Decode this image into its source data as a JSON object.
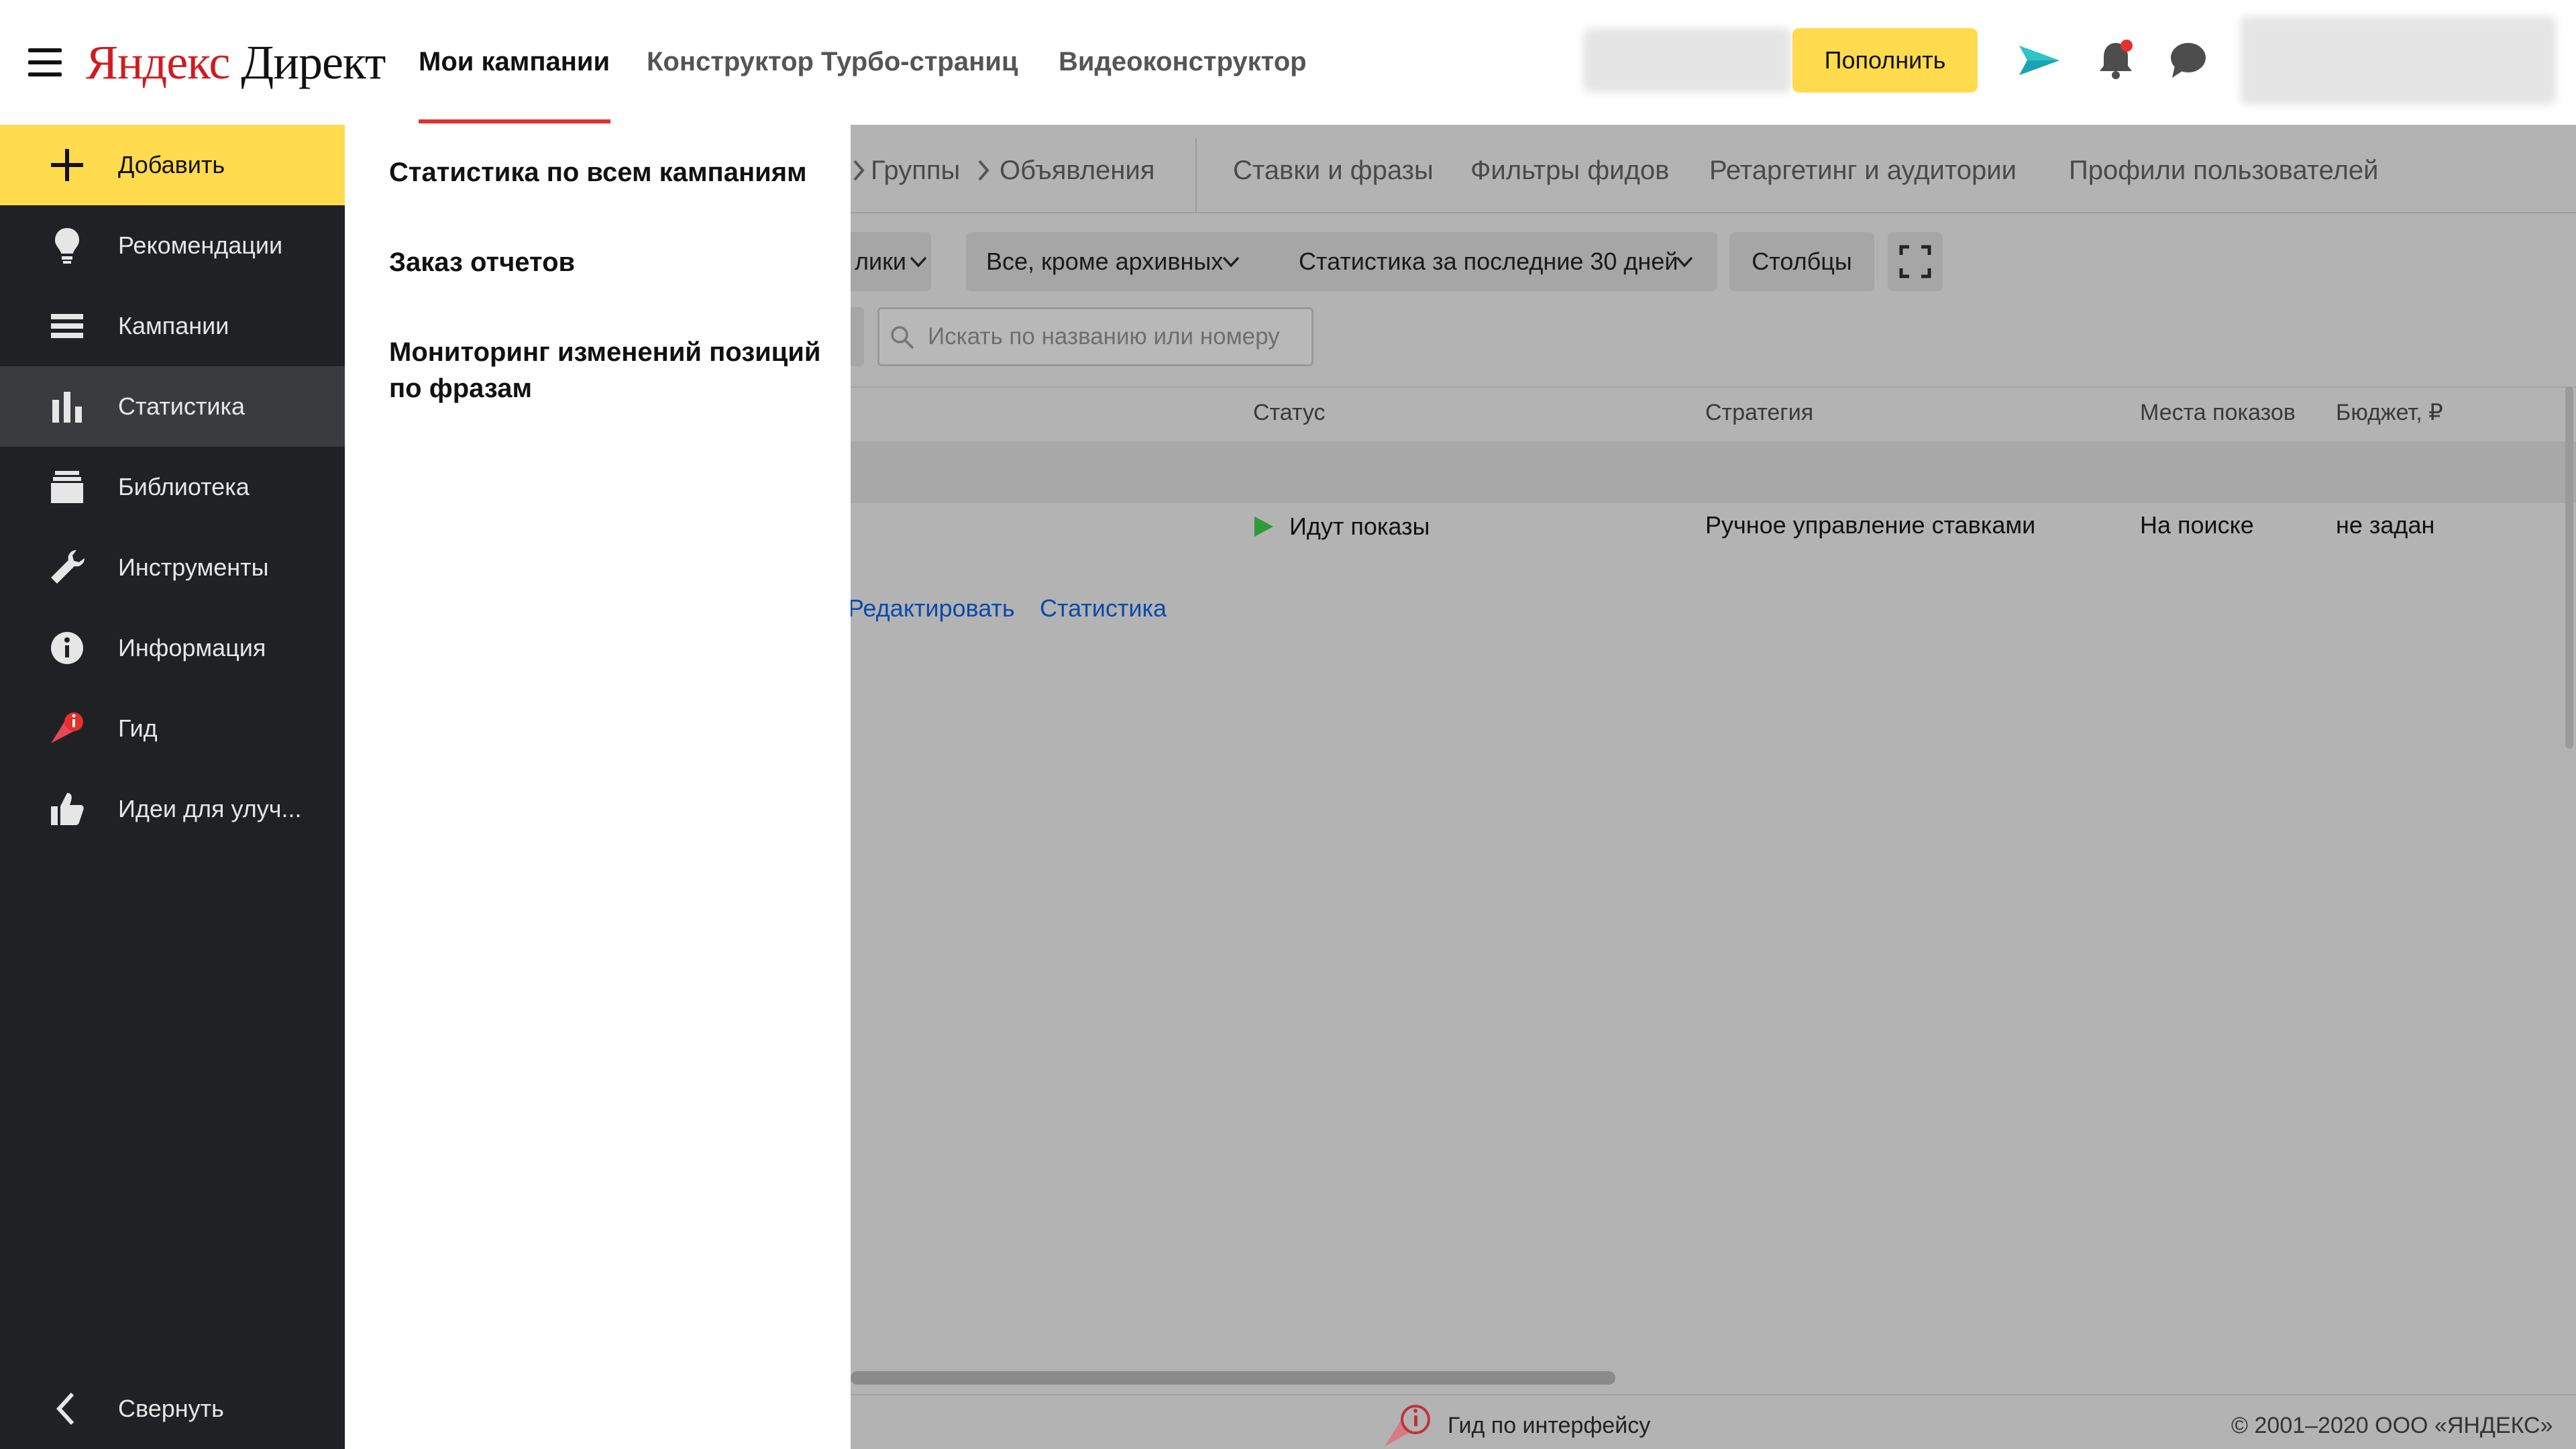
{
  "header": {
    "logo_brand": "Яндекс",
    "logo_product": "Директ",
    "tabs": [
      {
        "label": "Мои кампании",
        "active": true
      },
      {
        "label": "Конструктор Турбо-страниц",
        "active": false
      },
      {
        "label": "Видеоконструктор",
        "active": false
      }
    ],
    "topup_label": "Пополнить",
    "icons": [
      "send-icon",
      "bell-icon",
      "chat-icon"
    ]
  },
  "sidebar": {
    "items": [
      {
        "label": "Добавить",
        "icon": "plus-icon"
      },
      {
        "label": "Рекомендации",
        "icon": "lightbulb-icon"
      },
      {
        "label": "Кампании",
        "icon": "list-icon"
      },
      {
        "label": "Статистика",
        "icon": "bar-chart-icon"
      },
      {
        "label": "Библиотека",
        "icon": "library-icon"
      },
      {
        "label": "Инструменты",
        "icon": "wrench-icon"
      },
      {
        "label": "Информация",
        "icon": "info-icon"
      },
      {
        "label": "Гид",
        "icon": "guide-icon"
      },
      {
        "label": "Идеи для улуч...",
        "icon": "thumbs-up-icon"
      }
    ],
    "collapse_label": "Свернуть"
  },
  "dropdown": {
    "items": [
      "Статистика по всем кампаниям",
      "Заказ отчетов",
      "Мониторинг изменений позиций по фразам"
    ]
  },
  "main": {
    "breadcrumbs": [
      "Группы",
      "Объявления"
    ],
    "subnav": [
      "Ставки и фразы",
      "Фильтры фидов",
      "Ретаргетинг и аудитории",
      "Профили пользователей"
    ],
    "filters": {
      "partial": "лики",
      "archive": "Все, кроме архивных",
      "period": "Статистика за последние 30 дней",
      "columns": "Столбцы"
    },
    "search_placeholder": "Искать по названию или номеру",
    "table": {
      "headers": [
        "Статус",
        "Стратегия",
        "Места показов",
        "Бюджет, ₽"
      ],
      "row": {
        "status": "Идут показы",
        "strategy": "Ручное управление ставками",
        "placement": "На поиске",
        "budget": "не задан"
      },
      "actions": [
        "Редактировать",
        "Статистика"
      ]
    },
    "footer": {
      "guide": "Гид по интерфейсу",
      "copyright": "© 2001–2020 ООО «ЯНДЕКС»"
    }
  },
  "colors": {
    "accent_yellow": "#ffdb4d",
    "sidebar_bg": "#202124",
    "tab_underline": "#e5302c",
    "link_blue": "#0b4aa8",
    "status_green": "#2f9a3a"
  }
}
